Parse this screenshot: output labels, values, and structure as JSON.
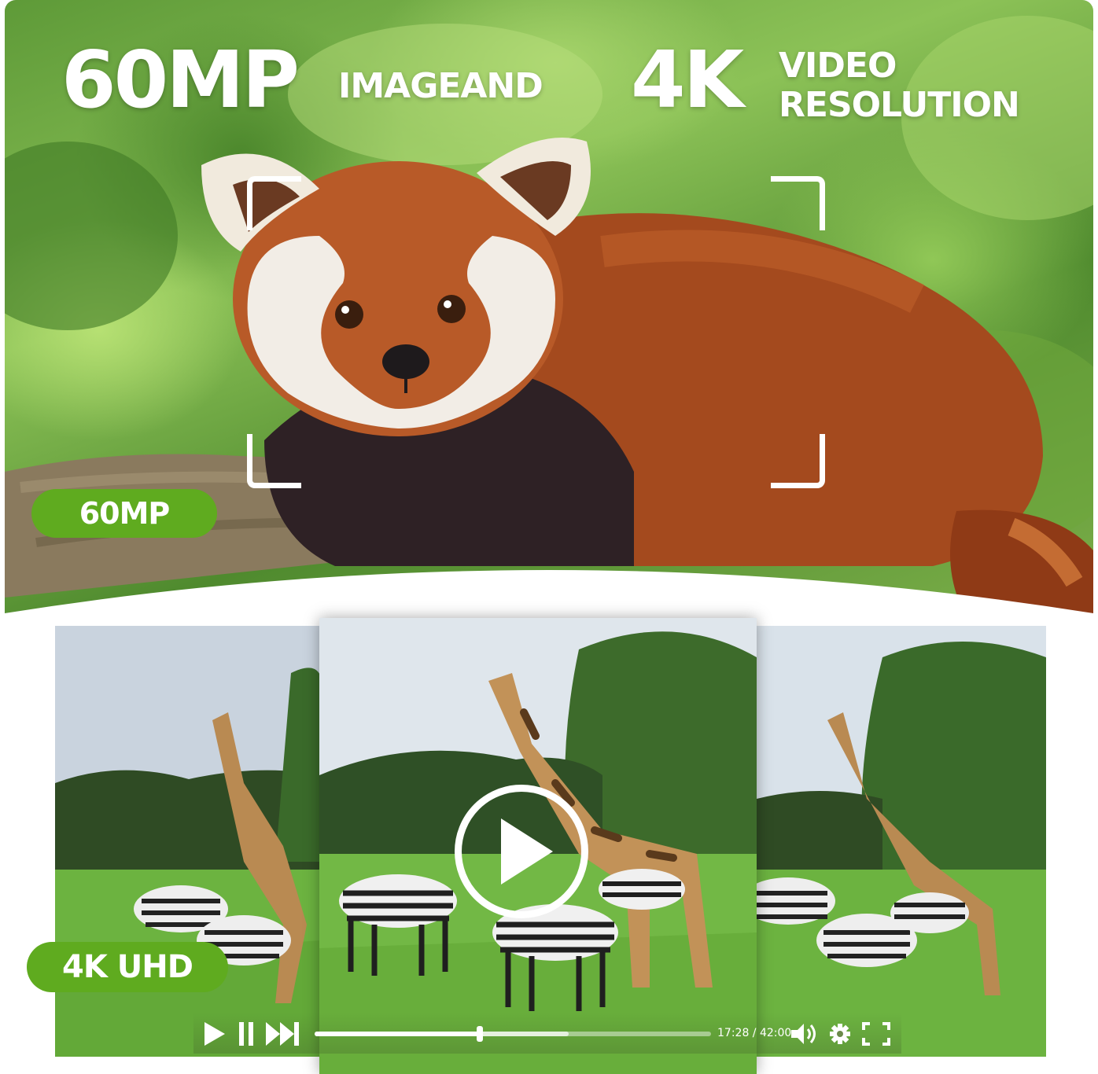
{
  "hero": {
    "megapixels": "60MP",
    "image_and": "IMAGEAND",
    "resolution_4k": "4K",
    "video": "VIDEO",
    "resolution": "RESOLUTION",
    "badge": "60MP"
  },
  "video_section": {
    "badge": "4K UHD",
    "player": {
      "time_current": "17:28",
      "time_separator": " / ",
      "time_total": "42:00",
      "progress": 0.416,
      "buffered": 0.64
    }
  },
  "colors": {
    "accent_green": "#5fab1f",
    "text": "#ffffff"
  },
  "icons": [
    "focus-corner",
    "play-icon",
    "pause-icon",
    "next-icon",
    "volume-icon",
    "gear-icon",
    "fullscreen-icon"
  ]
}
